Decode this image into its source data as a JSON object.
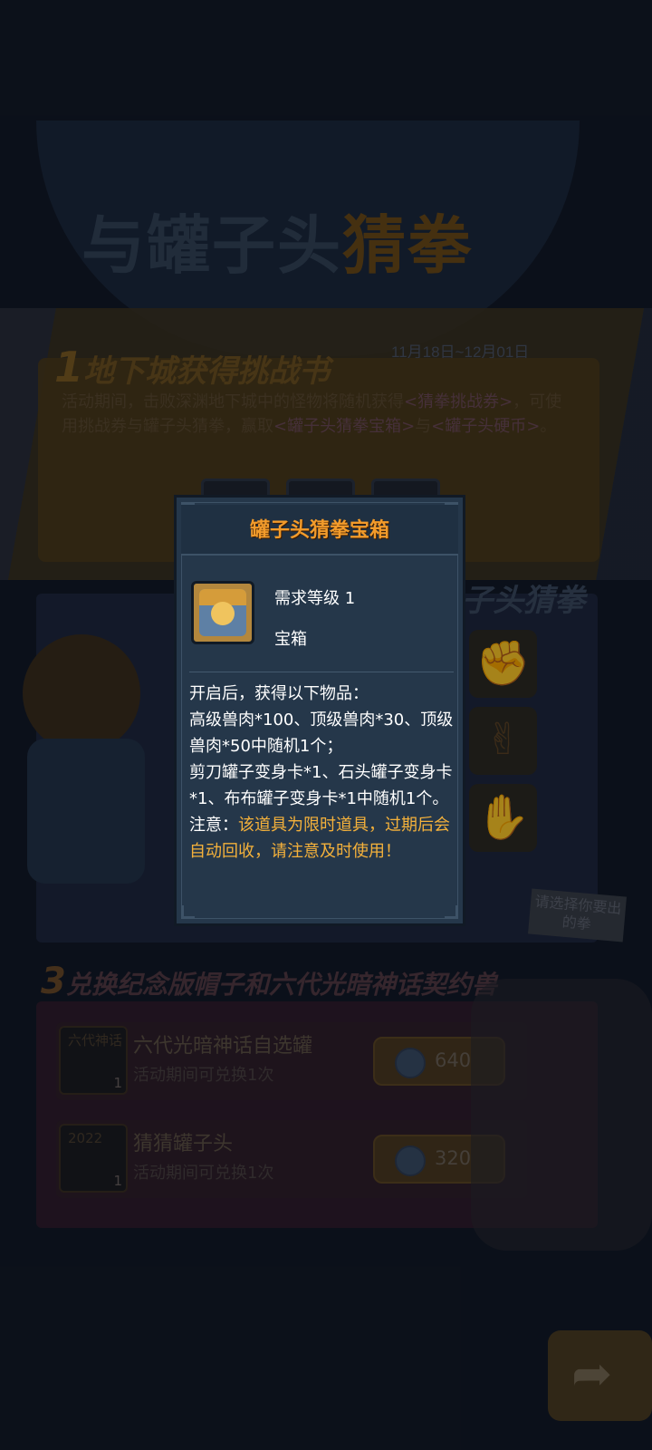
{
  "banner": {
    "title_part1": "与罐子头",
    "title_part2": "猜拳",
    "date_range": "11月18日~12月01日"
  },
  "section1": {
    "number": "1",
    "title": "地下城获得挑战书",
    "text_a": "活动期间，击败深渊地下城中的怪物将随机获得",
    "link_ticket": "<猜拳挑战券>",
    "text_b": "，可使用挑战券与罐子头猜拳，赢取",
    "link_chest": "<罐子头猜拳宝箱>",
    "text_c": "与",
    "link_coin": "<罐子头硬币>",
    "text_d": "。"
  },
  "section2": {
    "title": "子头猜拳",
    "choose_label": "请选择你要出的拳",
    "choices": [
      {
        "name": "rock",
        "glyph": "✊"
      },
      {
        "name": "scissors",
        "glyph": "✌"
      },
      {
        "name": "paper",
        "glyph": "✋"
      }
    ]
  },
  "section3": {
    "number": "3",
    "title": "兑换纪念版帽子和六代光暗神话契约兽",
    "rows": [
      {
        "icon_text": "六代神话",
        "qty": "1",
        "name": "六代光暗神话自选罐",
        "limit": "活动期间可兑换1次",
        "price": "640"
      },
      {
        "icon_text": "2022",
        "qty": "1",
        "name": "猜猜罐子头",
        "limit": "活动期间可兑换1次",
        "price": "320"
      }
    ]
  },
  "next_button_icon": "share-arrow-icon",
  "modal": {
    "title": "罐子头猜拳宝箱",
    "item_icon": "treasure-chest-icon",
    "required_level": "需求等级 1",
    "item_type": "宝箱",
    "desc_line1": "开启后，获得以下物品：",
    "desc_line2": "高级兽肉*100、顶级兽肉*30、顶级兽肉*50中随机1个；",
    "desc_line3": "剪刀罐子变身卡*1、石头罐子变身卡*1、布布罐子变身卡*1中随机1个。",
    "warn_label": "注意：",
    "warn_text": "该道具为限时道具，过期后会自动回收，请注意及时使用！"
  },
  "colors": {
    "modal_bg": "#25374a",
    "modal_title": "#f29b2b",
    "warning": "#f4b13b"
  }
}
